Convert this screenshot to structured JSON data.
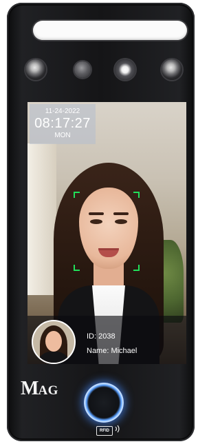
{
  "screen": {
    "date": "11-24-2022",
    "time": "08:17:27",
    "day": "MON"
  },
  "recognition": {
    "id_text": "ID: 2038",
    "name_text": "Name: Michael"
  },
  "branding": {
    "logo_m": "M",
    "logo_rest": "AG"
  },
  "rfid": {
    "label": "RFID"
  },
  "colors": {
    "face_frame": "#21e05a",
    "scan_glow": "#2d6fff"
  },
  "icons": {
    "sensors": [
      "ir-sensor-icon",
      "camera-lens-icon",
      "light-sensor-icon",
      "ir-sensor-icon"
    ],
    "scan": "fingerprint-scan-ring-icon",
    "rfid": "rfid-wave-icon"
  }
}
